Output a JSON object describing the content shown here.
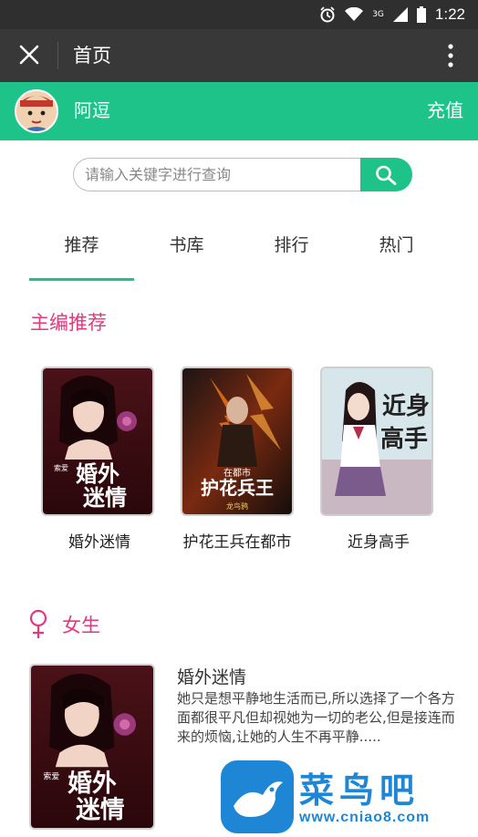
{
  "status_bar": {
    "time": "1:22",
    "network": "3G",
    "icons": [
      "alarm-icon",
      "wifi-icon",
      "signal-icon",
      "battery-icon"
    ]
  },
  "header": {
    "title": "首页",
    "close_icon": "close-icon",
    "more_icon": "more-vertical-icon"
  },
  "user": {
    "name": "阿逗",
    "recharge_label": "充值"
  },
  "search": {
    "placeholder": "请输入关键字进行查询",
    "icon": "search-icon"
  },
  "tabs": [
    {
      "label": "推荐",
      "active": true
    },
    {
      "label": "书库",
      "active": false
    },
    {
      "label": "排行",
      "active": false
    },
    {
      "label": "热门",
      "active": false
    }
  ],
  "editor_picks": {
    "title": "主编推荐",
    "books": [
      {
        "title": "婚外迷情",
        "cover_text": "婚外迷情",
        "cover_tag": "索爱"
      },
      {
        "title": "护花王兵在都市",
        "cover_text": "护花兵王",
        "cover_sub": "在都市",
        "cover_author": "龙鸟鸦"
      },
      {
        "title": "近身高手",
        "cover_text": "近身高手"
      }
    ]
  },
  "female_section": {
    "title": "女生",
    "icon": "female-icon",
    "book": {
      "title": "婚外迷情",
      "cover_text": "婚外迷情",
      "cover_tag": "索爱",
      "description": "她只是想平静地生活而已,所以选择了一个各方面都很平凡但却视她为一切的老公,但是接连而来的烦恼,让她的人生不再平静....."
    }
  },
  "watermark": {
    "text": "菜鸟吧",
    "url": "www.cniao8.com"
  },
  "colors": {
    "accent": "#1ec389",
    "section_title": "#e5367e",
    "top_bar": "#383838",
    "status_bar": "#2f2f2f"
  }
}
